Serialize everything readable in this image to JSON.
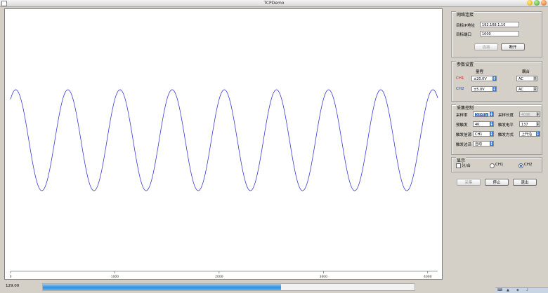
{
  "window": {
    "title": "TCPDemo"
  },
  "plot": {
    "x_ticks": [
      "0",
      "1000",
      "2000",
      "3000",
      "4000"
    ]
  },
  "chart_data": {
    "type": "line",
    "title": "",
    "xlabel": "",
    "ylabel": "",
    "xlim": [
      0,
      4096
    ],
    "x_ticks": [
      0,
      1000,
      2000,
      3000,
      4000
    ],
    "grid": false,
    "series": [
      {
        "waveform": "sine",
        "period_samples": 500,
        "cycles": 8.2,
        "phase_peak_at_x": 50,
        "amplitude_relative": 0.73,
        "color": "#3b3bd9"
      }
    ]
  },
  "status": {
    "value": "129.00",
    "progress_fraction": 0.64
  },
  "network": {
    "title": "网络连接",
    "ip_label": "目标IP地址",
    "ip_value": "192.168.1.10",
    "port_label": "目标端口",
    "port_value": "1000",
    "connect_label": "连接",
    "disconnect_label": "断开"
  },
  "params": {
    "title": "参数设置",
    "range_header": "量程",
    "coupling_header": "耦合",
    "ch1_label": "CH1",
    "ch2_label": "CH2",
    "ch1_range": "±20.0V",
    "ch2_range": "±5.0V",
    "ch1_coupling": "AC",
    "ch2_coupling": "AC"
  },
  "acq": {
    "title": "采集控制",
    "rate_label": "采样率",
    "rate_value": "50MHz",
    "length_label": "采样长度",
    "length_value": "4096",
    "pretrig_label": "预触发",
    "pretrig_value": "4K",
    "level_label": "触发电平",
    "level_value": "137",
    "source_label": "触发信源",
    "source_value": "CH1",
    "mode_label": "触发方式",
    "mode_value": "上升沿",
    "edge_label": "触发边沿",
    "edge_value": "自动"
  },
  "display": {
    "title": "显示",
    "split_label": "分/合",
    "ch1_label": "CH1",
    "ch2_label": "CH2"
  },
  "actions": {
    "acquire_label": "采集",
    "stop_label": "停止",
    "exit_label": "退出"
  },
  "colors": {
    "wave": "#3b3bd9",
    "ch1": "#d02020",
    "ch2": "#2040d0",
    "progress": "#2f8fe0"
  }
}
